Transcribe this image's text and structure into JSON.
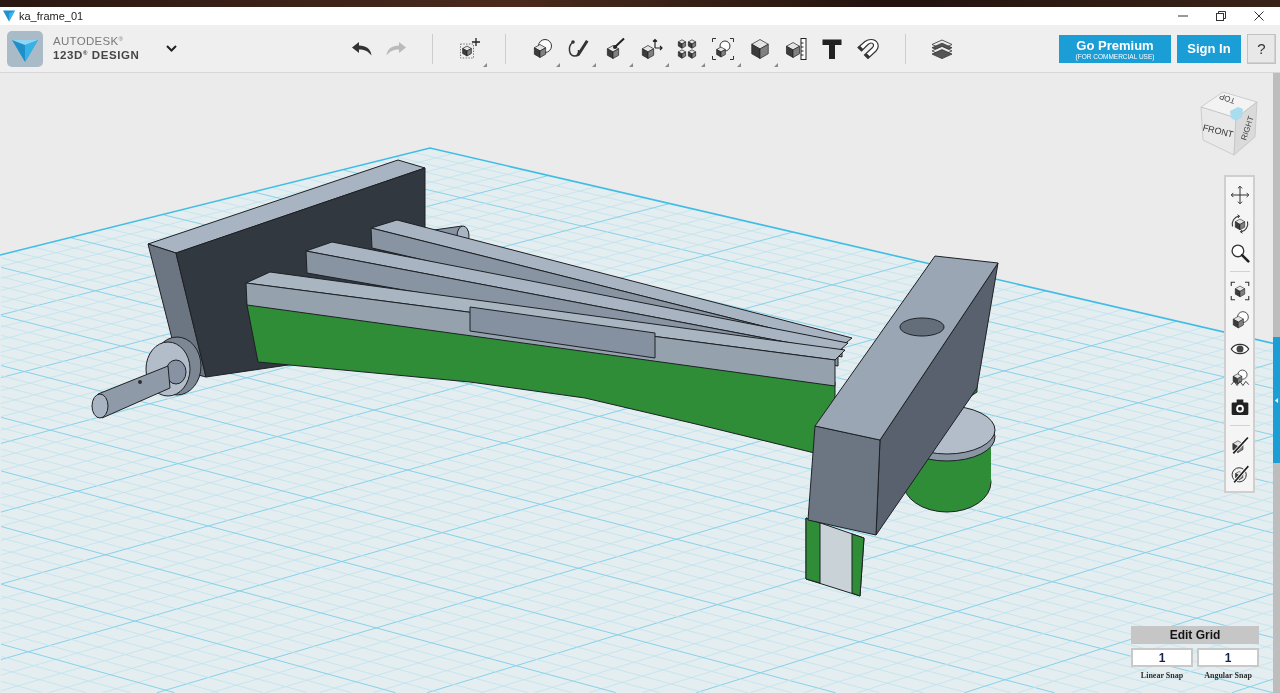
{
  "window": {
    "title": "ka_frame_01"
  },
  "brand": {
    "company": "AUTODESK$^{®}$",
    "product": "123D$^{®}$ DESIGN"
  },
  "toolbar": {
    "groups": [
      [
        {
          "kind": "undo",
          "disabled": false,
          "menu": false
        },
        {
          "kind": "redo",
          "disabled": true,
          "menu": false
        }
      ],
      [
        {
          "kind": "transform",
          "disabled": false,
          "menu": true
        }
      ],
      [
        {
          "kind": "primitives",
          "disabled": false,
          "menu": true
        },
        {
          "kind": "sketch",
          "disabled": false,
          "menu": true
        },
        {
          "kind": "construct",
          "disabled": false,
          "menu": true
        },
        {
          "kind": "modify",
          "disabled": false,
          "menu": true
        },
        {
          "kind": "pattern",
          "disabled": false,
          "menu": true
        },
        {
          "kind": "grouping",
          "disabled": false,
          "menu": true
        },
        {
          "kind": "combine",
          "disabled": false,
          "menu": true
        },
        {
          "kind": "measure",
          "disabled": false,
          "menu": false
        },
        {
          "kind": "text",
          "disabled": false,
          "menu": false
        },
        {
          "kind": "snap",
          "disabled": false,
          "menu": false
        }
      ],
      [
        {
          "kind": "material",
          "disabled": false,
          "menu": false
        }
      ]
    ]
  },
  "account": {
    "premium": {
      "label": "Go Premium",
      "note": "(FOR COMMERCIAL USE)"
    },
    "sign_in": "Sign In",
    "help": "?"
  },
  "view_cube": {
    "top": "TOP",
    "front": "FRONT",
    "right": "RIGHT"
  },
  "navigation": {
    "groups": [
      [
        {
          "kind": "pan"
        },
        {
          "kind": "orbit"
        },
        {
          "kind": "zoom"
        }
      ],
      [
        {
          "kind": "fit"
        },
        {
          "kind": "zoom_selected"
        },
        {
          "kind": "visibility"
        },
        {
          "kind": "material"
        },
        {
          "kind": "snapshot"
        }
      ],
      [
        {
          "kind": "edit"
        },
        {
          "kind": "hide"
        }
      ]
    ]
  },
  "edit_grid": {
    "title": "Edit Grid",
    "fields": [
      {
        "value": "1",
        "label": "Linear Snap"
      },
      {
        "value": "1",
        "label": "Angular Snap"
      }
    ]
  }
}
